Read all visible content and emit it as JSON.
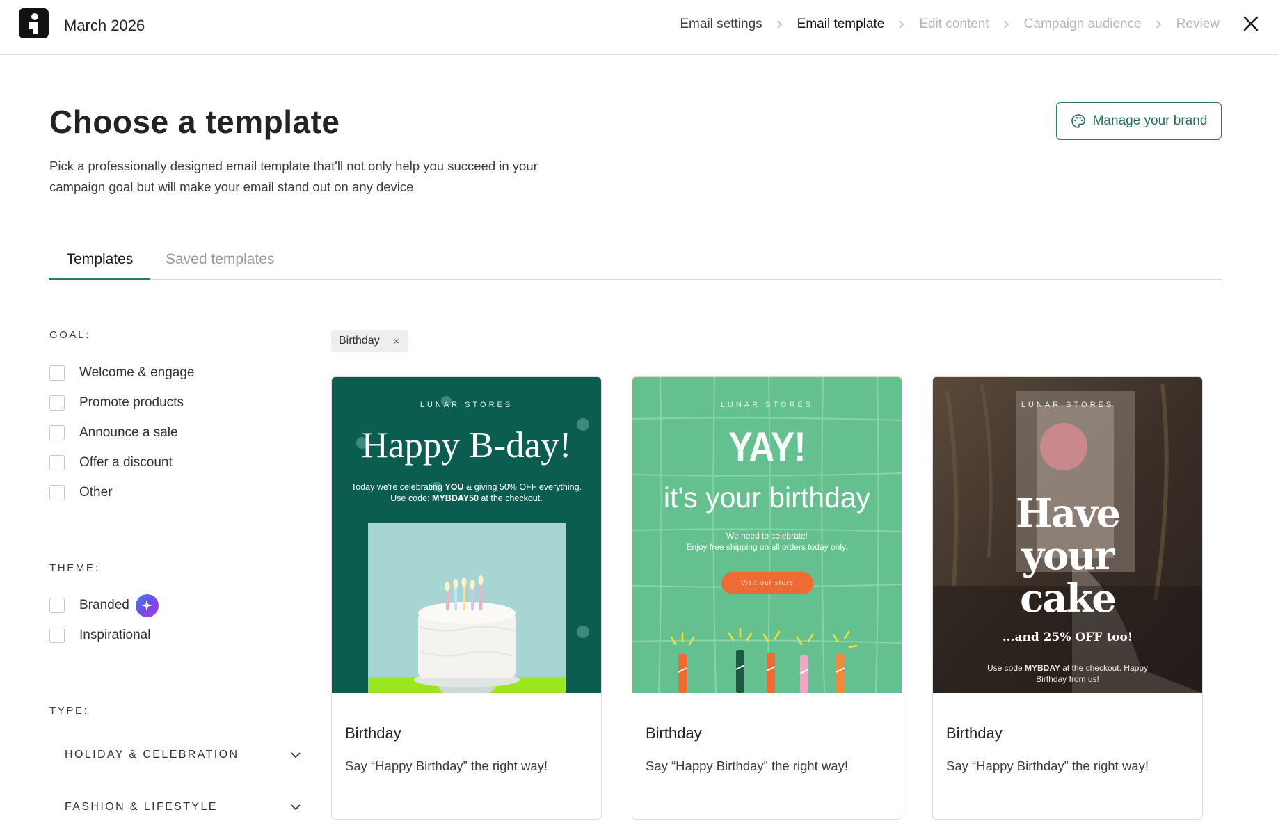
{
  "header": {
    "title": "March 2026",
    "steps": [
      {
        "label": "Email settings",
        "state": "done"
      },
      {
        "label": "Email template",
        "state": "active"
      },
      {
        "label": "Edit content",
        "state": "upcoming"
      },
      {
        "label": "Campaign audience",
        "state": "upcoming"
      },
      {
        "label": "Review",
        "state": "upcoming"
      }
    ],
    "close_icon": "close-icon"
  },
  "page": {
    "title": "Choose a template",
    "description": "Pick a professionally designed email template that'll not only help you succeed in your campaign goal but will make your email stand out on any device",
    "manage_brand_label": "Manage your brand",
    "manage_brand_icon": "palette-icon"
  },
  "tabs": [
    {
      "label": "Templates",
      "active": true
    },
    {
      "label": "Saved templates",
      "active": false
    }
  ],
  "filters": {
    "goal": {
      "heading": "GOAL:",
      "options": [
        "Welcome & engage",
        "Promote products",
        "Announce a sale",
        "Offer a discount",
        "Other"
      ]
    },
    "theme": {
      "heading": "THEME:",
      "options": [
        "Branded",
        "Inspirational"
      ]
    },
    "type": {
      "heading": "TYPE:",
      "options": [
        "HOLIDAY & CELEBRATION",
        "FASHION & LIFESTYLE"
      ]
    }
  },
  "active_filter_chip": {
    "label": "Birthday",
    "remove": "×"
  },
  "cards": [
    {
      "title": "Birthday",
      "description": "Say “Happy Birthday” the right way!",
      "preview": {
        "eyebrow": "LUNAR STORES",
        "headline": "Happy B-day!",
        "copy_pre": "Today we're celebrating ",
        "copy_bold1": "YOU",
        "copy_mid": " & giving 50% OFF everything.",
        "copy_line2_pre": "Use code: ",
        "copy_code": "MYBDAY50",
        "copy_line2_post": " at the checkout."
      }
    },
    {
      "title": "Birthday",
      "description": "Say “Happy Birthday” the right way!",
      "preview": {
        "eyebrow": "LUNAR STORES",
        "headline": "YAY!",
        "subheadline": "it's your birthday",
        "copy_line1": "We need to celebrate!",
        "copy_line2": "Enjoy free shipping on all orders today only.",
        "button": "Visit our store"
      }
    },
    {
      "title": "Birthday",
      "description": "Say “Happy Birthday” the right way!",
      "preview": {
        "eyebrow": "LUNAR STORES",
        "headline_lines": [
          "Have",
          "your",
          "cake"
        ],
        "subheadline": "...and 25% OFF too!",
        "copy_pre": "Use code ",
        "copy_code": "MYBDAY",
        "copy_post": " at the checkout. Happy",
        "copy_line2": "Birthday from us!"
      }
    }
  ],
  "colors": {
    "accent": "#2c7a6f",
    "card1_bg": "#0b5d4f",
    "card2_bg": "#64c18f",
    "card2_button": "#f06a34"
  }
}
